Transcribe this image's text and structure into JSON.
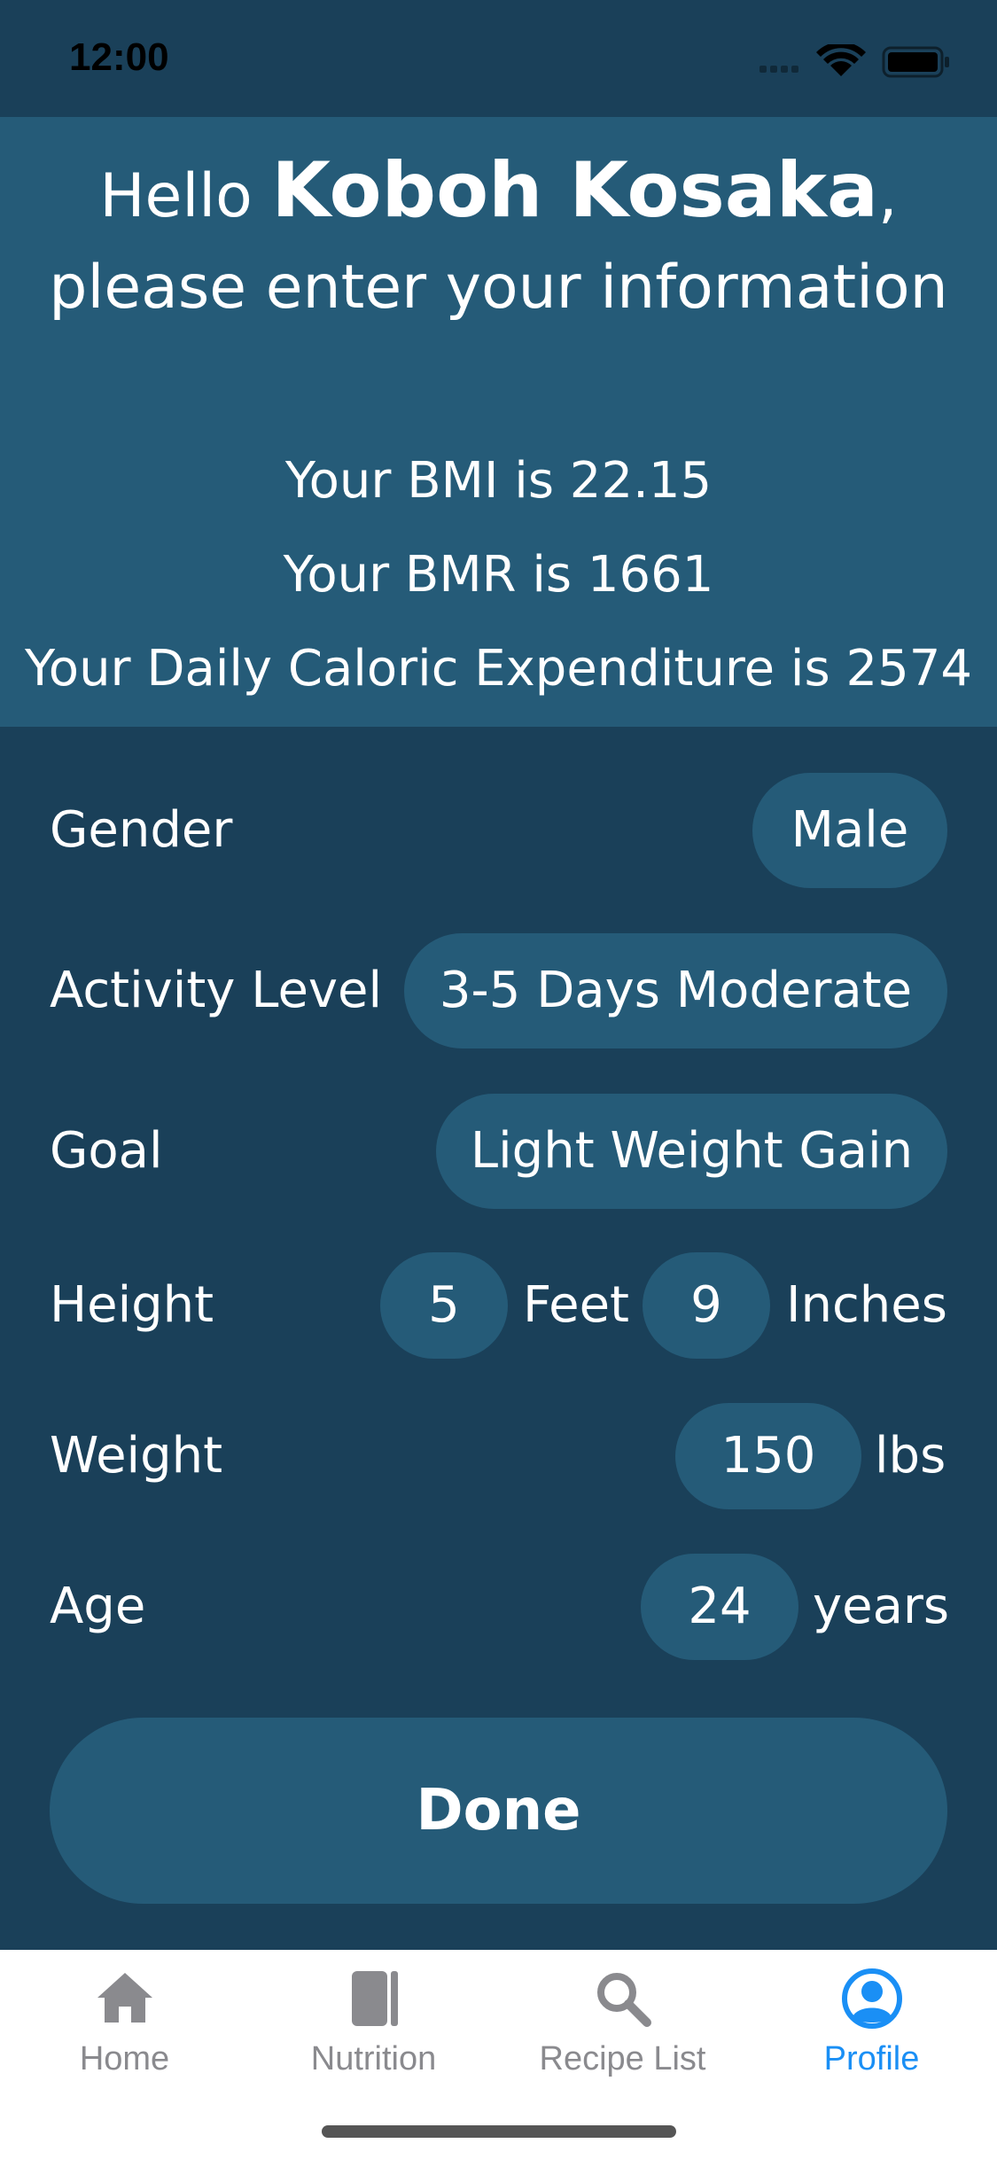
{
  "status_bar": {
    "time": "12:00"
  },
  "header": {
    "greeting_prefix": "Hello ",
    "user_name": "Koboh Kosaka",
    "greeting_suffix": ",",
    "prompt": "please enter your information",
    "bmi_text": "Your BMI is 22.15",
    "bmr_text": "Your BMR is 1661",
    "calories_text": "Your Daily Caloric Expenditure is 2574"
  },
  "form": {
    "gender": {
      "label": "Gender",
      "value": "Male"
    },
    "activity": {
      "label": "Activity Level",
      "value": "3-5 Days Moderate"
    },
    "goal": {
      "label": "Goal",
      "value": "Light Weight Gain"
    },
    "height": {
      "label": "Height",
      "feet": "5",
      "feet_unit": "Feet",
      "inches": "9",
      "inches_unit": "Inches"
    },
    "weight": {
      "label": "Weight",
      "value": "150",
      "unit": "lbs"
    },
    "age": {
      "label": "Age",
      "value": "24",
      "unit": "years"
    }
  },
  "done_button": {
    "label": "Done"
  },
  "tab_bar": {
    "tabs": [
      {
        "label": "Home",
        "icon": "house-icon",
        "active": false
      },
      {
        "label": "Nutrition",
        "icon": "book-icon",
        "active": false
      },
      {
        "label": "Recipe List",
        "icon": "search-icon",
        "active": false
      },
      {
        "label": "Profile",
        "icon": "person-circle-icon",
        "active": true
      }
    ]
  },
  "colors": {
    "background": "#1a4059",
    "header_background": "#255b78",
    "pill_background": "#255b78",
    "tab_active": "#1a8ff5",
    "tab_inactive": "#8a8a8e"
  }
}
